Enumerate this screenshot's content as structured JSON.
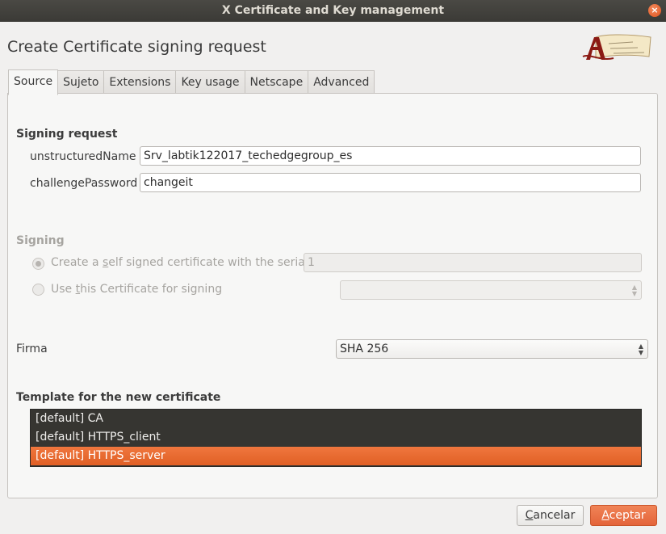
{
  "window": {
    "title": "X Certificate and Key management",
    "close_glyph": "×"
  },
  "dialog": {
    "title": "Create Certificate signing request"
  },
  "tabs": [
    {
      "label": "Source",
      "active": true
    },
    {
      "label": "Sujeto",
      "active": false
    },
    {
      "label": "Extensions",
      "active": false
    },
    {
      "label": "Key usage",
      "active": false
    },
    {
      "label": "Netscape",
      "active": false
    },
    {
      "label": "Advanced",
      "active": false
    }
  ],
  "signing_request": {
    "heading": "Signing request",
    "unstructured_label": "unstructuredName",
    "unstructured_value": "Srv_labtik122017_techedgegroup_es",
    "challenge_label": "challengePassword",
    "challenge_value": "changeit"
  },
  "signing": {
    "heading": "Signing",
    "self_signed_prefix": "Create a ",
    "self_signed_mnemonic": "s",
    "self_signed_suffix": "elf signed certificate with the serial",
    "serial_value": "1",
    "use_cert_prefix": "Use ",
    "use_cert_mnemonic": "t",
    "use_cert_suffix": "his Certificate for signing",
    "use_cert_value": ""
  },
  "firma": {
    "label": "Firma",
    "value": "SHA 256"
  },
  "template": {
    "heading": "Template for the new certificate",
    "items": [
      {
        "label": "[default] CA",
        "selected": false
      },
      {
        "label": "[default] HTTPS_client",
        "selected": false
      },
      {
        "label": "[default] HTTPS_server",
        "selected": true
      }
    ]
  },
  "buttons": {
    "cancel_mnemonic": "C",
    "cancel_rest": "ancelar",
    "accept_mnemonic": "A",
    "accept_rest": "ceptar"
  },
  "colors": {
    "accent": "#e9683a",
    "titlebar": "#3e3d39",
    "list_bg": "#363531"
  },
  "icons": {
    "logo": "xca-scroll-logo",
    "close": "close-icon",
    "combo_arrows": "updown-arrows-icon"
  }
}
